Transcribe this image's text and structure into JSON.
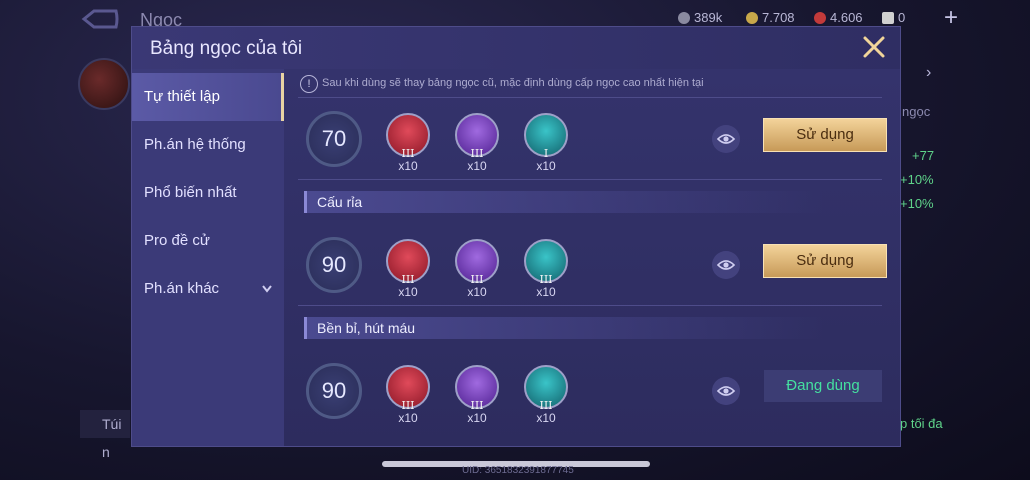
{
  "background": {
    "title": "Ngọc",
    "resources": [
      {
        "icon": "coin-icon",
        "value": "389k",
        "color": "#8a8aa0"
      },
      {
        "icon": "gold-icon",
        "value": "7.708",
        "color": "#c8a84a"
      },
      {
        "icon": "ruby-icon",
        "value": "4.606",
        "color": "#c23a3a"
      },
      {
        "icon": "card-icon",
        "value": "0",
        "color": "#d0d0d0"
      }
    ],
    "right_texts": [
      "ngọc",
      "+77",
      "+10%",
      "+10%"
    ],
    "bottom_left": "Túi n",
    "bottom_right": "p tối đa",
    "uid": "UID: 3651832391877745"
  },
  "modal": {
    "title": "Bảng ngọc của tôi",
    "notice": "Sau khi dùng sẽ thay bảng ngọc cũ, mặc định dùng cấp ngọc cao nhất hiện tại",
    "tabs": [
      {
        "label": "Tự thiết lập",
        "active": true
      },
      {
        "label": "Ph.án hệ thống"
      },
      {
        "label": "Phổ biến nhất"
      },
      {
        "label": "Pro đề cử"
      },
      {
        "label": "Ph.án khác",
        "dropdown": true
      }
    ],
    "pages": [
      {
        "section": "",
        "level": "70",
        "gems": [
          {
            "color": "red",
            "tier": "III",
            "count": "x10"
          },
          {
            "color": "purple",
            "tier": "III",
            "count": "x10"
          },
          {
            "color": "teal",
            "tier": "I",
            "count": "x10"
          }
        ],
        "button": "Sử dụng",
        "in_use": false
      },
      {
        "section": "Cấu rỉa",
        "level": "90",
        "gems": [
          {
            "color": "red",
            "tier": "III",
            "count": "x10"
          },
          {
            "color": "purple",
            "tier": "III",
            "count": "x10"
          },
          {
            "color": "teal",
            "tier": "III",
            "count": "x10"
          }
        ],
        "button": "Sử dụng",
        "in_use": false
      },
      {
        "section": "Bền bỉ, hút máu",
        "level": "90",
        "gems": [
          {
            "color": "red",
            "tier": "III",
            "count": "x10"
          },
          {
            "color": "purple",
            "tier": "III",
            "count": "x10"
          },
          {
            "color": "teal",
            "tier": "III",
            "count": "x10"
          }
        ],
        "button": "Đang dùng",
        "in_use": true
      }
    ]
  },
  "colors": {
    "gem_red": "#c0283a",
    "gem_purple": "#7a3fb8",
    "gem_teal": "#1f8f98",
    "accent_gold": "#e8c98a",
    "in_use_green": "#45e0a0"
  }
}
